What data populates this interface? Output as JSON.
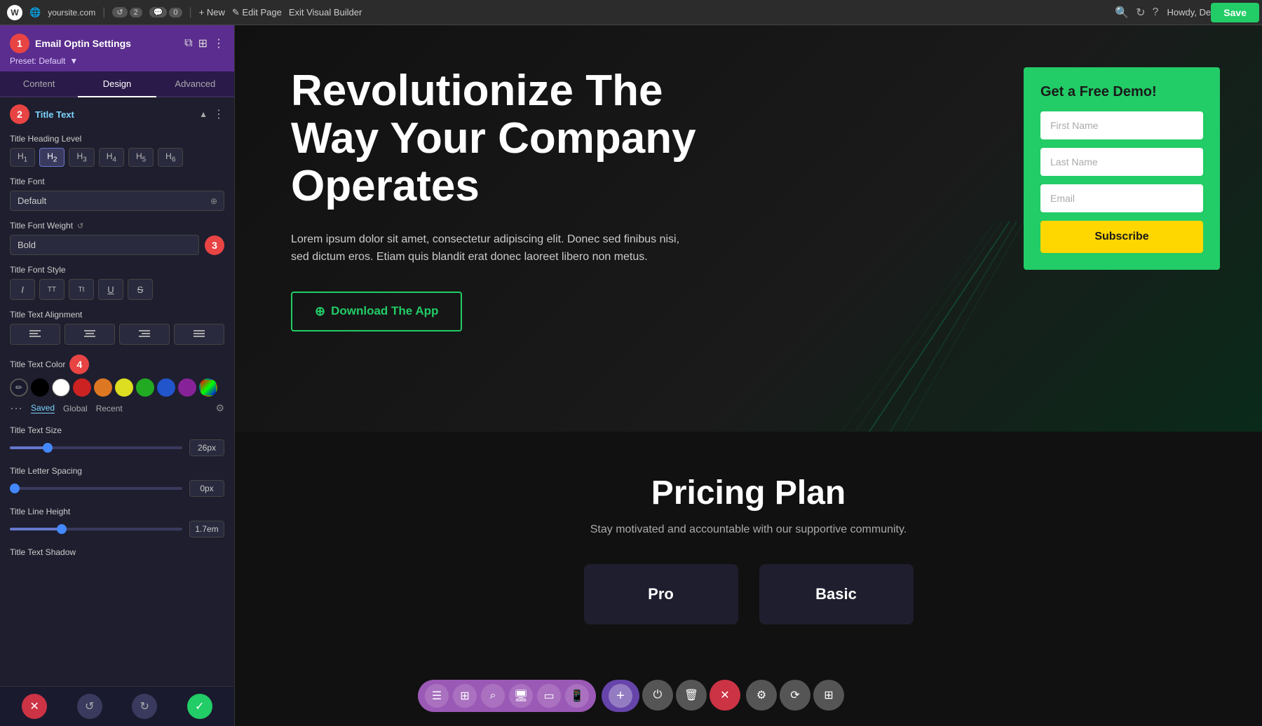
{
  "topbar": {
    "wp_logo": "W",
    "site_name": "yoursite.com",
    "undo_count": "2",
    "comment_count": "0",
    "new_label": "+ New",
    "edit_page_label": "✎ Edit Page",
    "exit_vb_label": "Exit Visual Builder",
    "howdy_label": "Howdy, Deanna"
  },
  "sidebar": {
    "title": "Email Optin Settings",
    "preset_label": "Preset: Default",
    "tabs": [
      "Content",
      "Design",
      "Advanced"
    ],
    "active_tab": "Design",
    "section_title": "Title Text",
    "step_badges": {
      "s1": "1",
      "s2": "2",
      "s3": "3",
      "s4": "4"
    },
    "heading_level": {
      "label": "Title Heading Level",
      "options": [
        "H1",
        "H2",
        "H3",
        "H4",
        "H5",
        "H6"
      ],
      "active": "H2"
    },
    "title_font": {
      "label": "Title Font",
      "value": "Default"
    },
    "title_font_weight": {
      "label": "Title Font Weight",
      "value": "Bold"
    },
    "title_font_style": {
      "label": "Title Font Style",
      "options": [
        "I",
        "TT",
        "Tt",
        "U",
        "S"
      ]
    },
    "title_text_alignment": {
      "label": "Title Text Alignment",
      "options": [
        "≡",
        "≡",
        "≡",
        "≡"
      ]
    },
    "title_text_color": {
      "label": "Title Text Color",
      "colors": [
        "pencil",
        "#000000",
        "#ffffff",
        "#cc2222",
        "#dd7722",
        "#dddd22",
        "#22aa22",
        "#2255cc",
        "#882299",
        "eraser"
      ],
      "color_tabs": [
        "Saved",
        "Global",
        "Recent"
      ]
    },
    "title_text_size": {
      "label": "Title Text Size",
      "value": "26px",
      "percent": 22
    },
    "title_letter_spacing": {
      "label": "Title Letter Spacing",
      "value": "0px",
      "percent": 0
    },
    "title_line_height": {
      "label": "Title Line Height",
      "value": "1.7em",
      "percent": 30
    },
    "title_text_shadow": {
      "label": "Title Text Shadow"
    }
  },
  "hero": {
    "title": "Revolutionize The Way Your Company Operates",
    "description": "Lorem ipsum dolor sit amet, consectetur adipiscing elit. Donec sed finibus nisi, sed dictum eros. Etiam quis blandit erat donec laoreet libero non metus.",
    "cta_label": "Download The App",
    "form": {
      "title": "Get a Free Demo!",
      "first_name_placeholder": "First Name",
      "last_name_placeholder": "Last Name",
      "email_placeholder": "Email",
      "subscribe_label": "Subscribe"
    }
  },
  "pricing": {
    "title": "Pricing Plan",
    "description": "Stay motivated and accountable with our supportive community.",
    "cards": [
      {
        "name": "Pro"
      },
      {
        "name": "Basic"
      }
    ]
  },
  "bottom_toolbar": {
    "tools": [
      "☰",
      "⊞",
      "⌕",
      "□",
      "□",
      "▬"
    ],
    "plus_label": "+",
    "power_label": "⏻",
    "trash_label": "🗑",
    "close_label": "✕",
    "settings_label": "⚙",
    "history_label": "⟳",
    "layout_label": "⊞"
  },
  "footer_actions": {
    "close_label": "✕",
    "undo_label": "↺",
    "redo_label": "↻",
    "confirm_label": "✓",
    "save_label": "Save"
  },
  "topbar_right": {
    "search_label": "🔍",
    "refresh_label": "↻",
    "help_label": "?"
  }
}
